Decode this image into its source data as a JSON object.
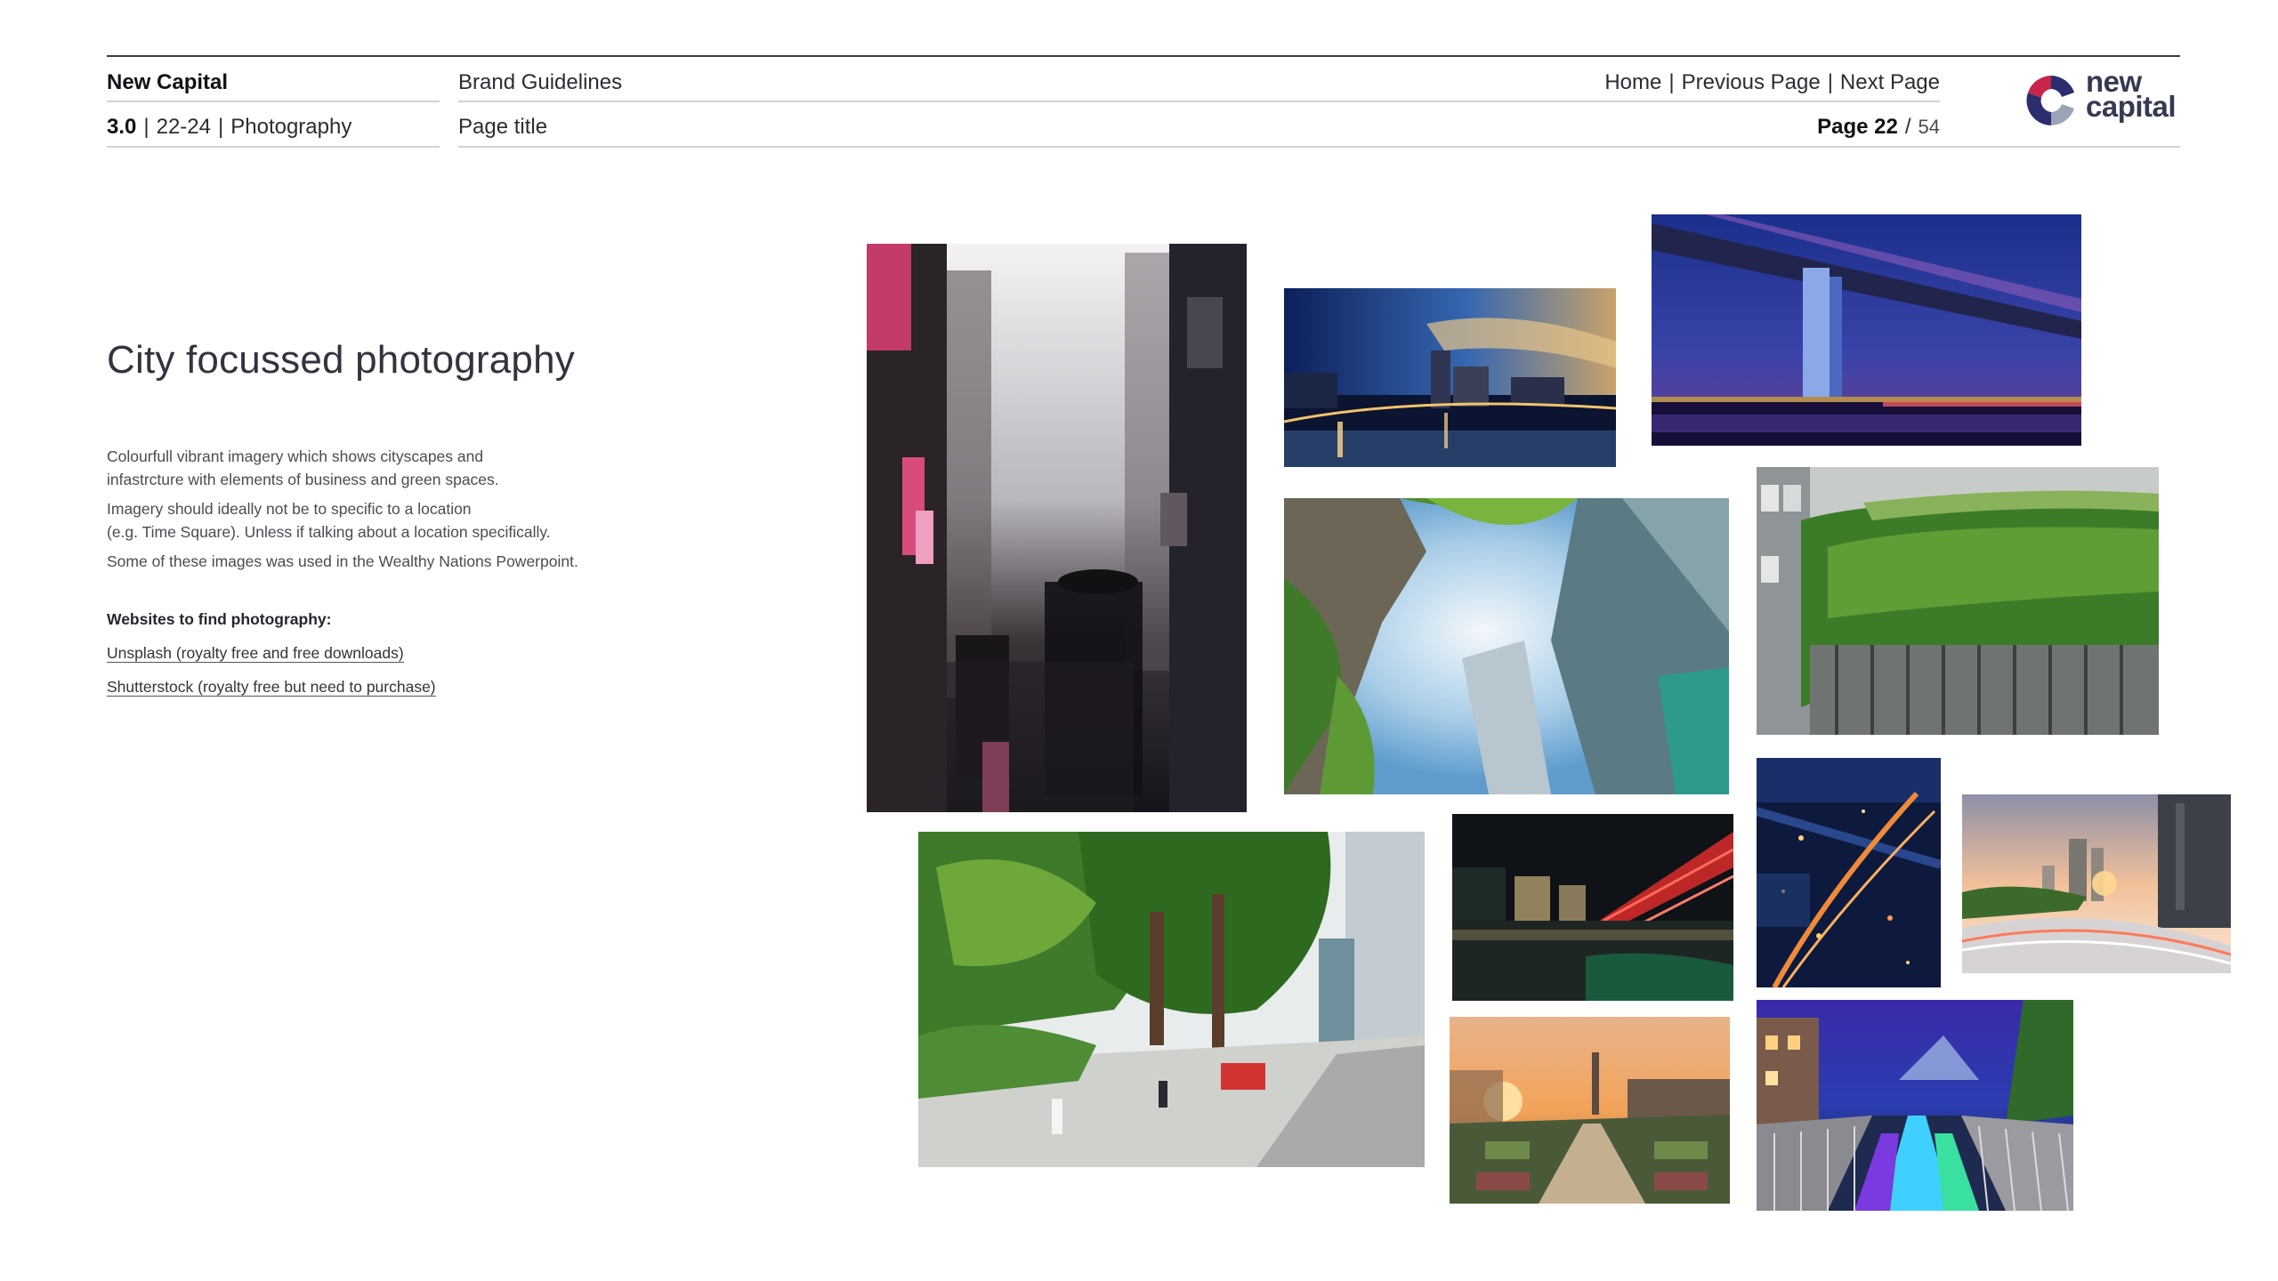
{
  "header": {
    "brand": "New Capital",
    "section_number": "3.0",
    "section_pages": "22-24",
    "section_name": "Photography",
    "doc_title": "Brand Guidelines",
    "page_title": "Page title",
    "nav": {
      "home": "Home",
      "previous": "Previous Page",
      "next": "Next Page"
    },
    "page_label": "Page 22",
    "page_total": "54",
    "logo": {
      "line1": "new",
      "line2": "capital"
    }
  },
  "content": {
    "heading": "City focussed photography",
    "paragraphs": [
      [
        "Colourfull vibrant imagery which shows cityscapes and",
        "infastrcture with elements of business and green spaces."
      ],
      [
        "Imagery should ideally not be to specific to a location",
        "(e.g. Time Square). Unless if talking about a location specifically."
      ],
      [
        "Some of these images was used in the Wealthy Nations Powerpoint."
      ]
    ],
    "links_heading": "Websites to find photography:",
    "links": [
      "Unsplash (royalty free and free downloads)",
      "Shutterstock (royalty free but need to purchase)"
    ]
  },
  "photos": [
    {
      "subject": "rainy-times-square-street"
    },
    {
      "subject": "harbour-skyline-dusk"
    },
    {
      "subject": "bridge-underside-night"
    },
    {
      "subject": "skyscrapers-looking-up-trees"
    },
    {
      "subject": "green-living-wall-building"
    },
    {
      "subject": "tree-lined-pedestrian-street"
    },
    {
      "subject": "helix-bridge-night"
    },
    {
      "subject": "aerial-city-night-lights"
    },
    {
      "subject": "highway-skyline-sunset"
    },
    {
      "subject": "city-garden-sunset"
    },
    {
      "subject": "illuminated-walkway-night"
    }
  ],
  "colors": {
    "rule_dark": "#3a3a52",
    "rule_light": "#d2d2d6",
    "logo_blue": "#2b2d6e",
    "logo_red": "#c8254a",
    "logo_grey": "#9aa4b6"
  }
}
